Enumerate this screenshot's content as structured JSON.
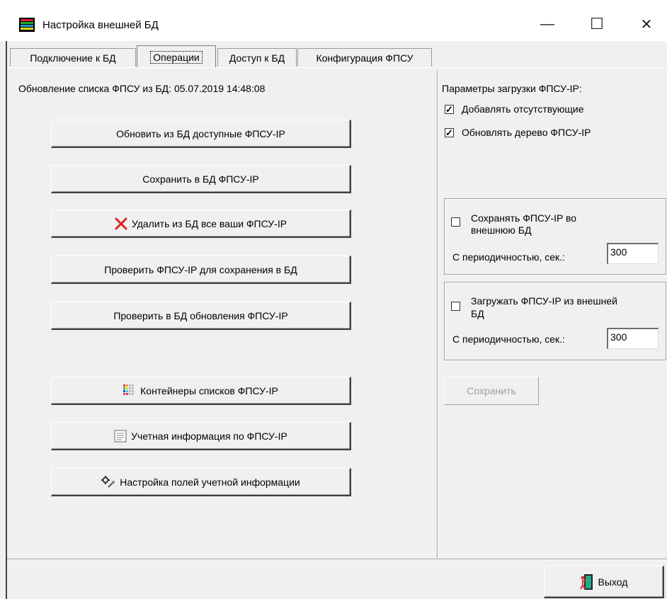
{
  "window": {
    "title": "Настройка внешней БД",
    "minimize": "—",
    "maximize": "☐",
    "close": "✕"
  },
  "tabs": [
    {
      "label": "Подключение к БД"
    },
    {
      "label": "Операции"
    },
    {
      "label": "Доступ к БД"
    },
    {
      "label": "Конфигурация ФПСУ"
    }
  ],
  "left": {
    "update_status": "Обновление списка ФПСУ из БД: 05.07.2019 14:48:08",
    "buttons": {
      "refresh": "Обновить из БД доступные  ФПСУ-IP",
      "save": "Сохранить в БД ФПСУ-IP",
      "delete": "Удалить из БД все ваши ФПСУ-IP",
      "check_save": "Проверить ФПСУ-IP для сохранения в БД",
      "check_updates": "Проверить в БД обновления ФПСУ-IP",
      "containers": "Контейнеры списков ФПСУ-IP",
      "accounting": "Учетная информация по ФПСУ-IP",
      "fields_setup": "Настройка полей учетной информации"
    }
  },
  "right": {
    "params_title": "Параметры загрузки ФПСУ-IP:",
    "add_missing": {
      "label": "Добавлять отсутствующие",
      "checked": true
    },
    "update_tree": {
      "label": "Обновлять дерево ФПСУ-IP",
      "checked": true
    },
    "save_group": {
      "label_line1": "Сохранять ФПСУ-IP во",
      "label_line2": "внешнюю БД",
      "checked": false,
      "period_label": "С периодичностью, сек.:",
      "period_value": "300"
    },
    "load_group": {
      "label_line1": "Загружать ФПСУ-IP из внешней",
      "label_line2": "БД",
      "checked": false,
      "period_label": "С периодичностью, сек.:",
      "period_value": "300"
    },
    "save_button": "Сохранить"
  },
  "footer": {
    "exit_button": "Выход"
  }
}
